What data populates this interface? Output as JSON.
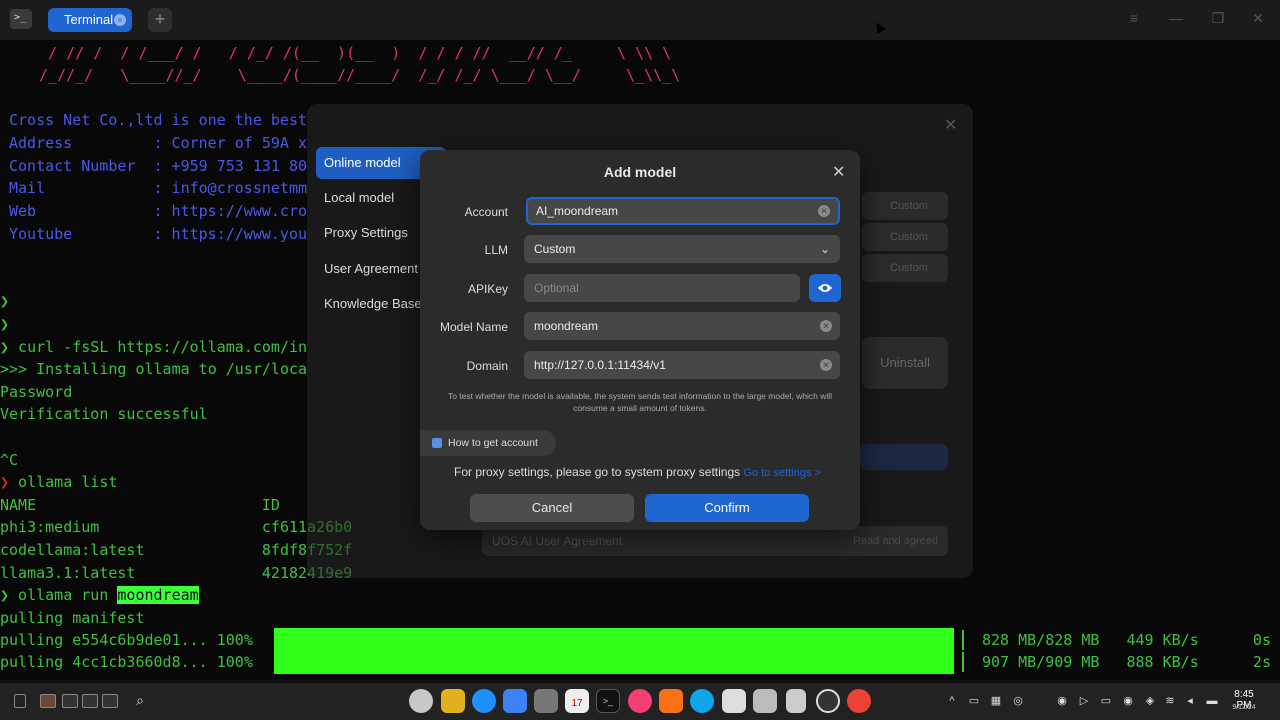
{
  "titlebar": {
    "tab_label": "Terminal",
    "tab_close": "×",
    "new_tab": "+",
    "menu": "≡",
    "minimize": "—",
    "maximize": "❐",
    "close": "✕"
  },
  "terminal": {
    "ascii_line1": "  / // /  / /___/ /   / /_/ /(__  )(__  )  / / / //  __// /_     \\ \\\\ \\",
    "ascii_line2": " /_//_/   \\____//_/    \\____/(____//____/  /_/ /_/ \\___/ \\__/     \\_\\\\_\\",
    "company_line": "Cross Net Co.,ltd is one the best",
    "info_address": "Address         : Corner of 59A x",
    "info_contact": "Contact Number  : +959 753 131 80",
    "info_mail": "Mail            : info@crossnetmm",
    "info_web": "Web             : https://www.cro",
    "info_youtube": "Youtube         : https://www.you",
    "prompt1": "❯",
    "prompt2": "❯",
    "cmd_curl": "❯ curl -fsSL https://ollama.com/in",
    "installing": ">>> Installing ollama to /usr/loca",
    "password": "Password",
    "verification": "Verification successful",
    "ctrl_c": "^C",
    "list_prompt": "❯",
    "list_cmd": " ollama list",
    "list_header": "NAME                         ID",
    "list_row1": "phi3:medium                  cf611a26b0",
    "list_row2": "codellama:latest             8fdf8f752f",
    "list_row3": "llama3.1:latest              42182419e9",
    "run_prefix": "❯ ollama run ",
    "run_model": "moondream",
    "pulling_manifest": "pulling manifest",
    "pull1_left": "pulling e554c6b9de01... 100%",
    "pull1_right": "828 MB/828 MB   449 KB/s      0s",
    "pull2_left": "pulling 4cc1cb3660d8... 100%",
    "pull2_right": "907 MB/909 MB   888 KB/s      2s"
  },
  "settings": {
    "close": "✕",
    "sidebar": [
      {
        "label": "Online model"
      },
      {
        "label": "Local model"
      },
      {
        "label": "Proxy Settings"
      },
      {
        "label": "User Agreement"
      },
      {
        "label": "Knowledge Base M"
      }
    ],
    "bg_rows": [
      "Custom",
      "Custom",
      "Custom"
    ],
    "uninstall": "Uninstall",
    "agreement_label": "UOS AI User Agreement",
    "agreement_status": "Read and agreed"
  },
  "dialog": {
    "title": "Add model",
    "close": "✕",
    "account_label": "Account",
    "account_value": "AI_moondream",
    "llm_label": "LLM",
    "llm_value": "Custom",
    "apikey_label": "APIKey",
    "apikey_placeholder": "Optional",
    "model_name_label": "Model Name",
    "model_name_value": "moondream",
    "domain_label": "Domain",
    "domain_value": "http://127.0.0.1:11434/v1",
    "note": "To test whether the model is available, the system sends test information to the large model, which will consume a small amount of tokens.",
    "how_to": "How to get account",
    "proxy_text": "For proxy settings, please go to system proxy settings ",
    "proxy_link": "Go to settings >",
    "cancel": "Cancel",
    "confirm": "Confirm"
  },
  "taskbar": {
    "calendar_day": "17",
    "time": "8:45 PM",
    "date": "9/12/24"
  },
  "colors": {
    "accent": "#1f66d0",
    "terminal_green": "#3ec23e",
    "progress_green": "#30ff1a"
  }
}
